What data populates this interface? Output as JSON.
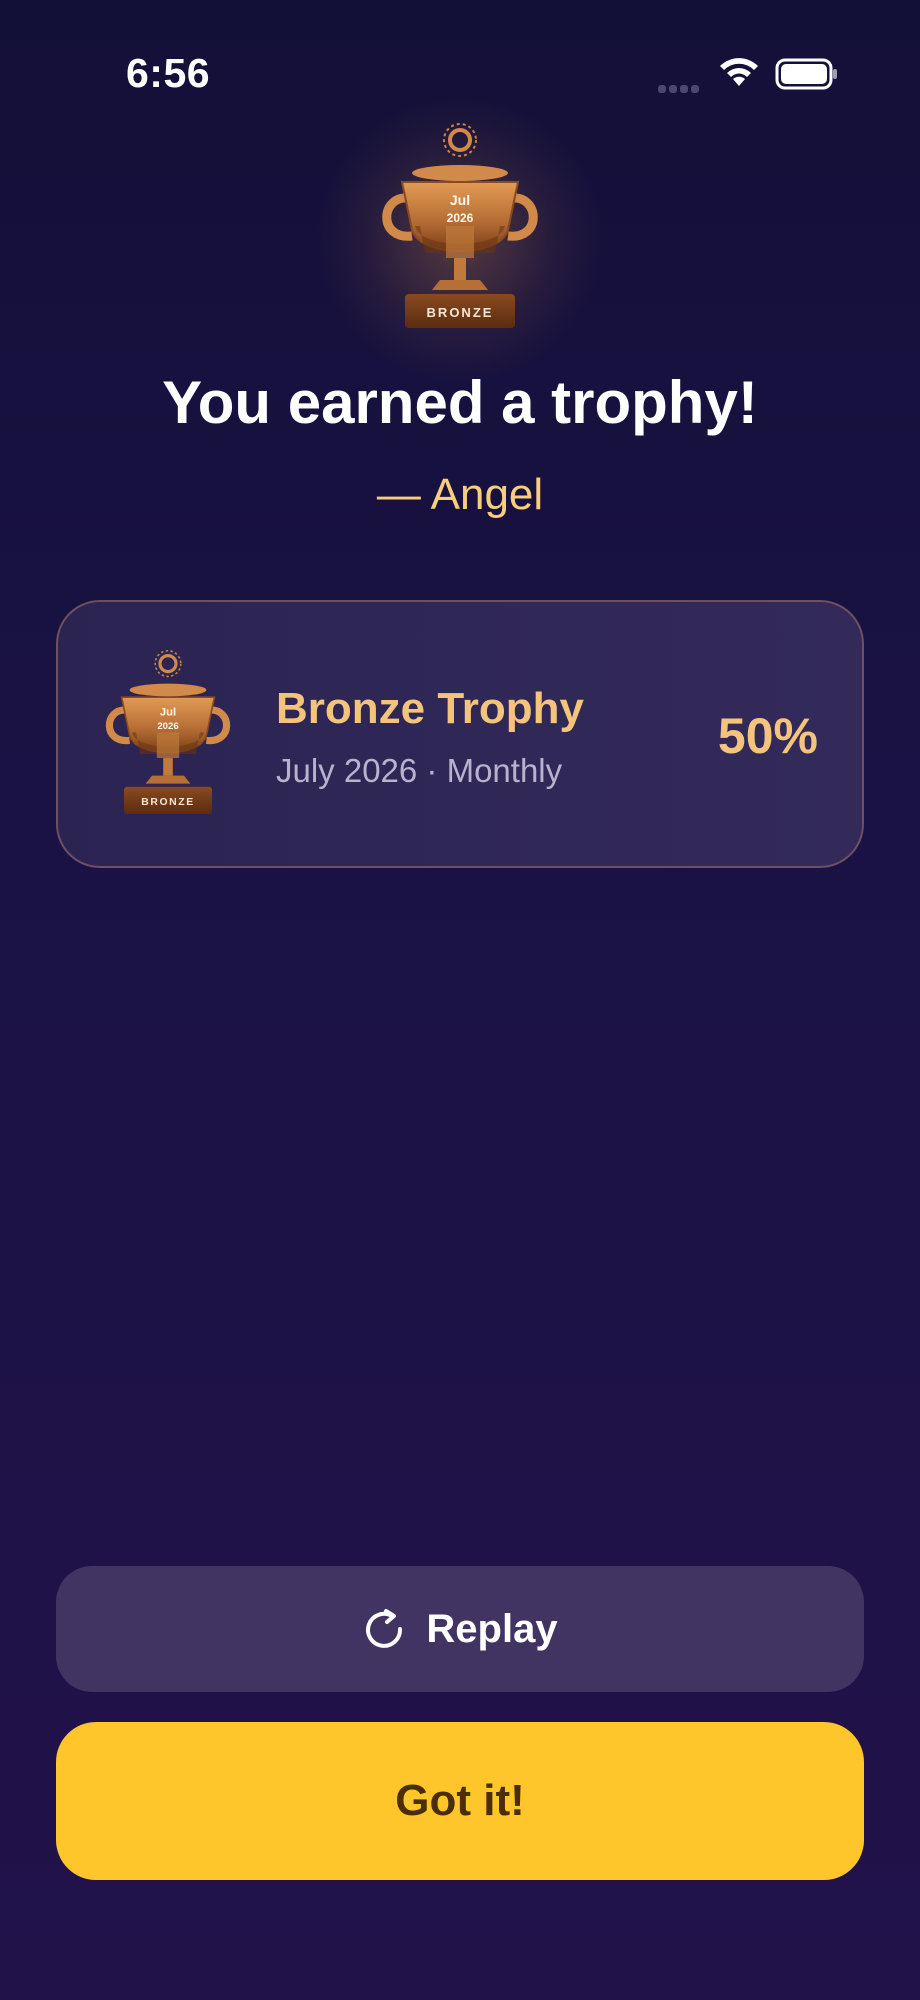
{
  "status_bar": {
    "time": "6:56",
    "icons": [
      "signal-icon",
      "wifi-icon",
      "battery-icon"
    ]
  },
  "hero": {
    "trophy": {
      "month": "Jul",
      "year": "2026",
      "tier_label": "BRONZE",
      "icon": "trophy-icon"
    },
    "title": "You earned a trophy!",
    "subtitle": "— Angel"
  },
  "trophy_card": {
    "trophy": {
      "month": "Jul",
      "year": "2026",
      "tier_label": "BRONZE",
      "icon": "trophy-icon"
    },
    "title": "Bronze Trophy",
    "subtitle": "July 2026 · Monthly",
    "percent": "50%"
  },
  "buttons": {
    "replay_label": "Replay",
    "replay_icon": "replay-icon",
    "got_it_label": "Got it!"
  },
  "colors": {
    "accent_gold": "#f4c47c",
    "primary_button": "#ffc62c",
    "secondary_button": "#413463",
    "bronze": "#b86f36"
  }
}
